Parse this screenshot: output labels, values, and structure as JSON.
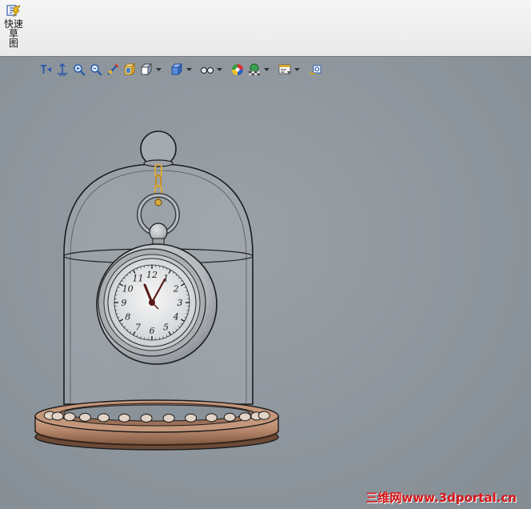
{
  "ribbon": {
    "quick_sketch_label_line1": "快速草",
    "quick_sketch_label_line2": "图"
  },
  "heads_up_toolbar": {
    "buttons": [
      {
        "icon": "previous-view-icon"
      },
      {
        "icon": "zoom-to-fit-icon"
      },
      {
        "icon": "zoom-to-area-icon"
      },
      {
        "icon": "zoom-in-out-icon"
      },
      {
        "icon": "section-view-icon"
      },
      {
        "icon": "view-orientation-icon"
      },
      {
        "icon": "display-style-icon"
      },
      {
        "icon": "hide-show-items-icon"
      },
      {
        "icon": "edit-appearance-icon"
      },
      {
        "icon": "apply-scene-icon"
      },
      {
        "icon": "view-settings-icon"
      },
      {
        "icon": "rotate-view-icon"
      }
    ]
  },
  "model": {
    "dial_numerals": [
      "12",
      "1",
      "2",
      "3",
      "4",
      "5",
      "6",
      "7",
      "8",
      "9",
      "10",
      "11"
    ]
  },
  "watermark": {
    "text": "三维网www.3dportal.cn"
  },
  "colors": {
    "viewport_bg": "#8f979e",
    "wood": "#b4866a",
    "chain_gold": "#d9a93a",
    "watermark_red": "#d8161a"
  }
}
